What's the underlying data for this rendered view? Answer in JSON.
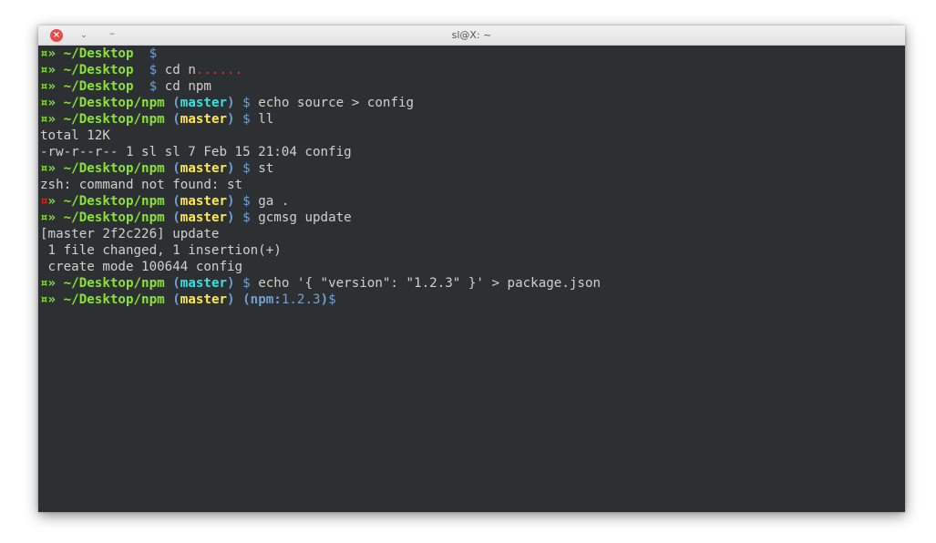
{
  "window": {
    "title": "sl@X: ~",
    "buttons": {
      "close": "×",
      "restore": "⌄",
      "minimize": "–"
    }
  },
  "colors": {
    "background": "#2d3033",
    "green": "#8ae234",
    "red": "#ef2929",
    "yellow": "#fce94f",
    "cyan": "#34e2e2",
    "blue": "#729fcf",
    "text": "#d0d0cc"
  },
  "lines": [
    [
      {
        "t": "¤",
        "c": "green"
      },
      {
        "t": "» ",
        "c": "green"
      },
      {
        "t": "~/Desktop",
        "c": "green"
      },
      {
        "t": "  ",
        "c": "white"
      },
      {
        "t": "$",
        "c": "blue"
      }
    ],
    [
      {
        "t": "¤",
        "c": "green"
      },
      {
        "t": "» ",
        "c": "green"
      },
      {
        "t": "~/Desktop",
        "c": "green"
      },
      {
        "t": "  ",
        "c": "white"
      },
      {
        "t": "$",
        "c": "blue"
      },
      {
        "t": " cd n",
        "c": "white"
      },
      {
        "t": "......",
        "c": "red"
      }
    ],
    [
      {
        "t": "¤",
        "c": "green"
      },
      {
        "t": "» ",
        "c": "green"
      },
      {
        "t": "~/Desktop",
        "c": "green"
      },
      {
        "t": "  ",
        "c": "white"
      },
      {
        "t": "$",
        "c": "blue"
      },
      {
        "t": " cd npm",
        "c": "white"
      }
    ],
    [
      {
        "t": "¤",
        "c": "green"
      },
      {
        "t": "» ",
        "c": "green"
      },
      {
        "t": "~/Desktop/npm",
        "c": "green"
      },
      {
        "t": " ",
        "c": "white"
      },
      {
        "t": "(",
        "c": "bblue"
      },
      {
        "t": "master",
        "c": "cyan"
      },
      {
        "t": ")",
        "c": "bblue"
      },
      {
        "t": " ",
        "c": "white"
      },
      {
        "t": "$",
        "c": "blue"
      },
      {
        "t": " echo source > config",
        "c": "white"
      }
    ],
    [
      {
        "t": "¤",
        "c": "green"
      },
      {
        "t": "» ",
        "c": "green"
      },
      {
        "t": "~/Desktop/npm",
        "c": "green"
      },
      {
        "t": " ",
        "c": "white"
      },
      {
        "t": "(",
        "c": "bblue"
      },
      {
        "t": "master",
        "c": "yellow"
      },
      {
        "t": ")",
        "c": "bblue"
      },
      {
        "t": " ",
        "c": "white"
      },
      {
        "t": "$",
        "c": "blue"
      },
      {
        "t": " ll",
        "c": "white"
      }
    ],
    [
      {
        "t": "total 12K",
        "c": "white"
      }
    ],
    [
      {
        "t": "-rw-r--r-- 1 sl sl 7 Feb 15 21:04 config",
        "c": "white"
      }
    ],
    [
      {
        "t": "¤",
        "c": "green"
      },
      {
        "t": "» ",
        "c": "green"
      },
      {
        "t": "~/Desktop/npm",
        "c": "green"
      },
      {
        "t": " ",
        "c": "white"
      },
      {
        "t": "(",
        "c": "bblue"
      },
      {
        "t": "master",
        "c": "yellow"
      },
      {
        "t": ")",
        "c": "bblue"
      },
      {
        "t": " ",
        "c": "white"
      },
      {
        "t": "$",
        "c": "blue"
      },
      {
        "t": " st",
        "c": "white"
      }
    ],
    [
      {
        "t": "zsh: command not found: st",
        "c": "white"
      }
    ],
    [
      {
        "t": "¤",
        "c": "red"
      },
      {
        "t": "» ",
        "c": "green"
      },
      {
        "t": "~/Desktop/npm",
        "c": "green"
      },
      {
        "t": " ",
        "c": "white"
      },
      {
        "t": "(",
        "c": "bblue"
      },
      {
        "t": "master",
        "c": "yellow"
      },
      {
        "t": ")",
        "c": "bblue"
      },
      {
        "t": " ",
        "c": "white"
      },
      {
        "t": "$",
        "c": "blue"
      },
      {
        "t": " ga .",
        "c": "white"
      }
    ],
    [
      {
        "t": "¤",
        "c": "green"
      },
      {
        "t": "» ",
        "c": "green"
      },
      {
        "t": "~/Desktop/npm",
        "c": "green"
      },
      {
        "t": " ",
        "c": "white"
      },
      {
        "t": "(",
        "c": "bblue"
      },
      {
        "t": "master",
        "c": "yellow"
      },
      {
        "t": ")",
        "c": "bblue"
      },
      {
        "t": " ",
        "c": "white"
      },
      {
        "t": "$",
        "c": "blue"
      },
      {
        "t": " gcmsg update",
        "c": "white"
      }
    ],
    [
      {
        "t": "[master 2f2c226] update",
        "c": "white"
      }
    ],
    [
      {
        "t": " 1 file changed, 1 insertion(+)",
        "c": "white"
      }
    ],
    [
      {
        "t": " create mode 100644 config",
        "c": "white"
      }
    ],
    [
      {
        "t": "¤",
        "c": "green"
      },
      {
        "t": "» ",
        "c": "green"
      },
      {
        "t": "~/Desktop/npm",
        "c": "green"
      },
      {
        "t": " ",
        "c": "white"
      },
      {
        "t": "(",
        "c": "bblue"
      },
      {
        "t": "master",
        "c": "cyan"
      },
      {
        "t": ")",
        "c": "bblue"
      },
      {
        "t": " ",
        "c": "white"
      },
      {
        "t": "$",
        "c": "blue"
      },
      {
        "t": " echo '{ \"version\": \"1.2.3\" }' > package.json",
        "c": "white"
      }
    ],
    [
      {
        "t": "¤",
        "c": "green"
      },
      {
        "t": "» ",
        "c": "green"
      },
      {
        "t": "~/Desktop/npm",
        "c": "green"
      },
      {
        "t": " ",
        "c": "white"
      },
      {
        "t": "(",
        "c": "bblue"
      },
      {
        "t": "master",
        "c": "yellow"
      },
      {
        "t": ")",
        "c": "bblue"
      },
      {
        "t": " ",
        "c": "white"
      },
      {
        "t": "(npm:",
        "c": "bblue"
      },
      {
        "t": "1.2.3",
        "c": "blue"
      },
      {
        "t": ")",
        "c": "bblue"
      },
      {
        "t": "$",
        "c": "blue"
      }
    ]
  ]
}
